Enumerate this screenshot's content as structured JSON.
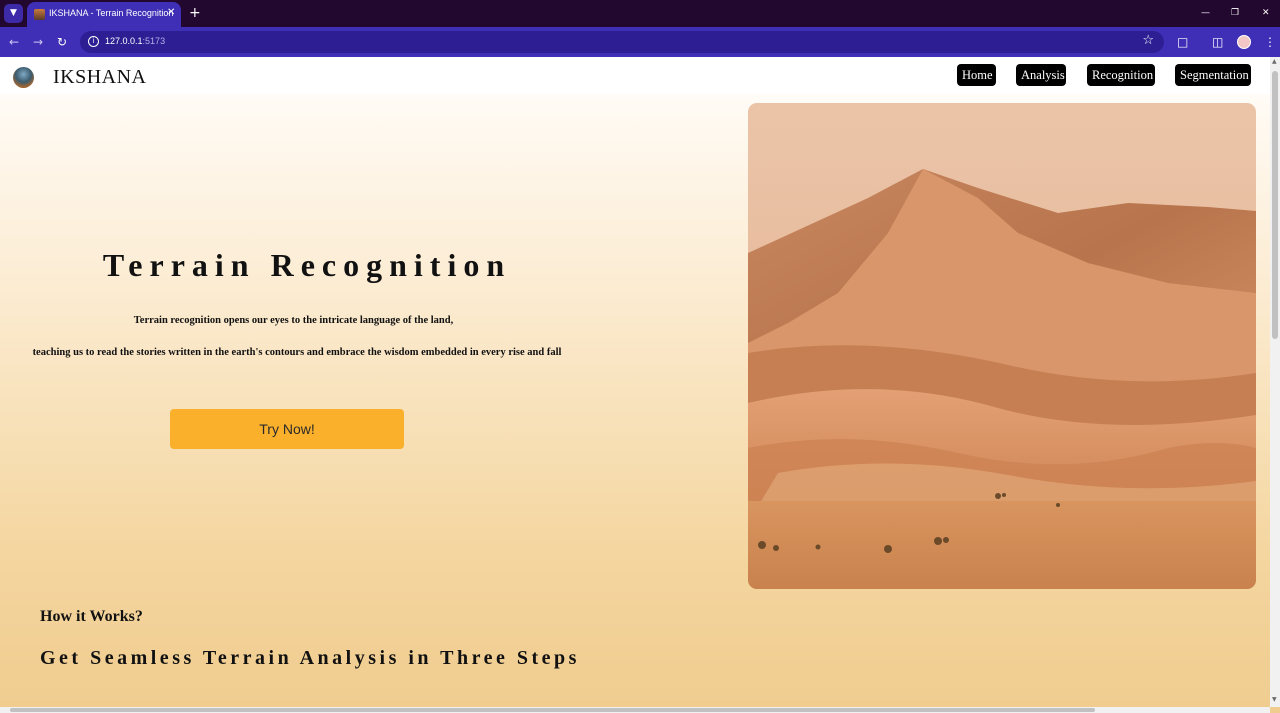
{
  "browser": {
    "tab_title": "IKSHANA - Terrain Recognition",
    "url_host": "127.0.0.1",
    "url_port": ":5173",
    "icons": {
      "tab_menu": "chevron-down-icon",
      "close_tab": "close-icon",
      "new_tab": "plus-icon",
      "back": "back-arrow-icon",
      "forward": "forward-arrow-icon",
      "reload": "reload-icon",
      "site_info": "info-icon",
      "bookmark": "star-icon",
      "extensions": "puzzle-icon",
      "side_panel": "side-panel-icon",
      "profile": "avatar",
      "menu": "kebab-menu-icon",
      "minimize": "minimize-icon",
      "restore": "restore-icon",
      "close_window": "close-window-icon"
    }
  },
  "site": {
    "brand": "IKSHANA",
    "nav": [
      {
        "label": "Home"
      },
      {
        "label": "Analysis"
      },
      {
        "label": "Recognition"
      },
      {
        "label": "Segmentation"
      }
    ]
  },
  "hero": {
    "title": "Terrain Recognition",
    "line1": "Terrain recognition opens our eyes to the intricate language of the land,",
    "line2": "teaching us to read the stories written in the earth's contours and embrace the wisdom embedded in every rise and fall",
    "cta_label": "Try Now!",
    "image": "desert-sand-dunes-image"
  },
  "how": {
    "label": "How it Works?",
    "title": "Get Seamless Terrain Analysis in Three Steps"
  },
  "colors": {
    "tab_strip": "#22072f",
    "toolbar": "#3e2fb6",
    "cta": "#fbb02c",
    "nav_button": "#000000"
  }
}
